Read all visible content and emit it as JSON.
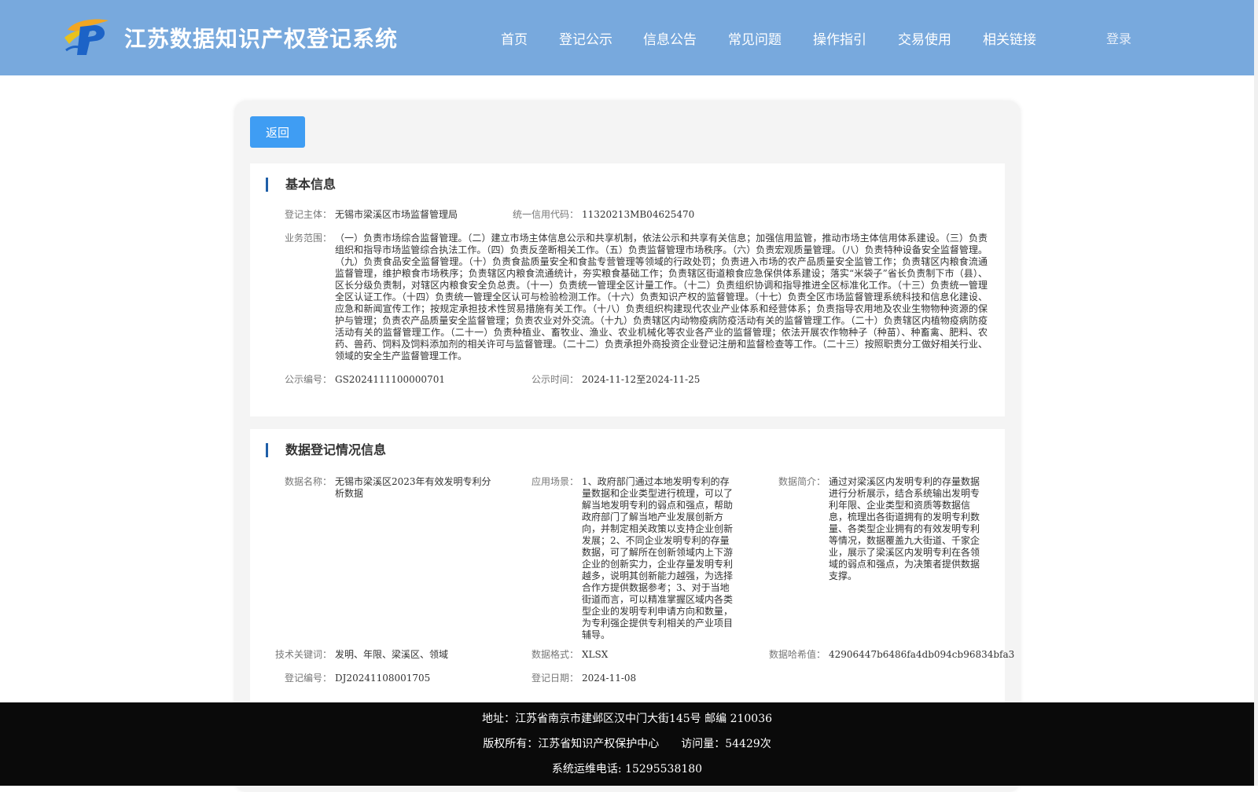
{
  "header": {
    "title": "江苏数据知识产权登记系统",
    "nav": [
      "首页",
      "登记公示",
      "信息公告",
      "常见问题",
      "操作指引",
      "交易使用",
      "相关链接"
    ],
    "login": "登录"
  },
  "back_label": "返回",
  "basic": {
    "heading": "基本信息",
    "subject_label": "登记主体：",
    "subject": "无锡市梁溪区市场监督管理局",
    "credit_label": "统一信用代码：",
    "credit": "11320213MB04625470",
    "scope_label": "业务范围：",
    "scope": "（一）负责市场综合监督管理。（二）建立市场主体信息公示和共享机制，依法公示和共享有关信息；加强信用监管，推动市场主体信用体系建设。（三）负责组织和指导市场监管综合执法工作。（四）负责反垄断相关工作。（五）负责监督管理市场秩序。（六）负责宏观质量管理。（八）负责特种设备安全监督管理。（九）负责食品安全监督管理。（十）负责食盐质量安全和食盐专营管理等领域的行政处罚；负责进入市场的农产品质量安全监管工作；负责辖区内粮食流通监督管理，维护粮食市场秩序；负责辖区内粮食流通统计，夯实粮食基础工作；负责辖区街道粮食应急保供体系建设；落实“米袋子”省长负责制下市（县）、区长分级负责制，对辖区内粮食安全负总责。（十一）负责统一管理全区计量工作。（十二）负责组织协调和指导推进全区标准化工作。（十三）负责统一管理全区认证工作。（十四）负责统一管理全区认可与检验检测工作。（十六）负责知识产权的监督管理。（十七）负责全区市场监督管理系统科技和信息化建设、应急和新闻宣传工作；按规定承担技术性贸易措施有关工作。（十八）负责组织构建现代农业产业体系和经营体系；负责指导农用地及农业生物物种资源的保护与管理；负责农产品质量安全监督管理；负责农业对外交流。（十九）负责辖区内动物疫病防疫活动有关的监督管理工作。（二十）负责辖区内植物疫病防疫活动有关的监督管理工作。（二十一）负责种植业、畜牧业、渔业、农业机械化等农业各产业的监督管理；依法开展农作物种子（种苗）、种畜禽、肥料、农药、兽药、饲料及饲料添加剂的相关许可与监督管理。（二十二）负责承担外商投资企业登记注册和监督检查等工作。（二十三）按照职责分工做好相关行业、领域的安全生产监督管理工作。",
    "pub_no_label": "公示编号：",
    "pub_no": "GS2024111100000701",
    "pub_time_label": "公示时间：",
    "pub_time": "2024-11-12至2024-11-25"
  },
  "data_info": {
    "heading": "数据登记情况信息",
    "name_label": "数据名称：",
    "name": "无锡市梁溪区2023年有效发明专利分析数据",
    "scene_label": "应用场景：",
    "scene": "1、政府部门通过本地发明专利的存量数据和企业类型进行梳理，可以了解当地发明专利的弱点和强点，帮助政府部门了解当地产业发展创新方向，并制定相关政策以支持企业创新发展；2、不同企业发明专利的存量数据，可了解所在创新领域内上下游企业的创新实力，企业存量发明专利越多，说明其创新能力越强，为选择合作方提供数据参考；3、对于当地街道而言，可以精准掌握区域内各类型企业的发明专利申请方向和数量，为专利强企提供专利相关的产业项目辅导。",
    "intro_label": "数据简介：",
    "intro": "通过对梁溪区内发明专利的存量数据进行分析展示，结合系统输出发明专利年限、企业类型和资质等数据信息，梳理出各街道拥有的发明专利数量、各类型企业拥有的有效发明专利等情况，数据覆盖九大街道、千家企业，展示了梁溪区内发明专利在各领域的弱点和强点，为决策者提供数据支撑。",
    "keywords_label": "技术关键词：",
    "keywords": "发明、年限、梁溪区、领域",
    "format_label": "数据格式：",
    "format": "XLSX",
    "hash_label": "数据哈希值：",
    "hash": "42906447b6486fa4db094cb96834bfa3",
    "reg_no_label": "登记编号：",
    "reg_no": "DJ20241108001705",
    "reg_date_label": "登记日期：",
    "reg_date": "2024-11-08"
  },
  "footer": {
    "address": "地址：江苏省南京市建邺区汉中门大街145号 邮编 210036",
    "copyright": "版权所有：江苏省知识产权保护中心　　访问量：54429次",
    "phone": "系统运维电话: 15295538180"
  }
}
